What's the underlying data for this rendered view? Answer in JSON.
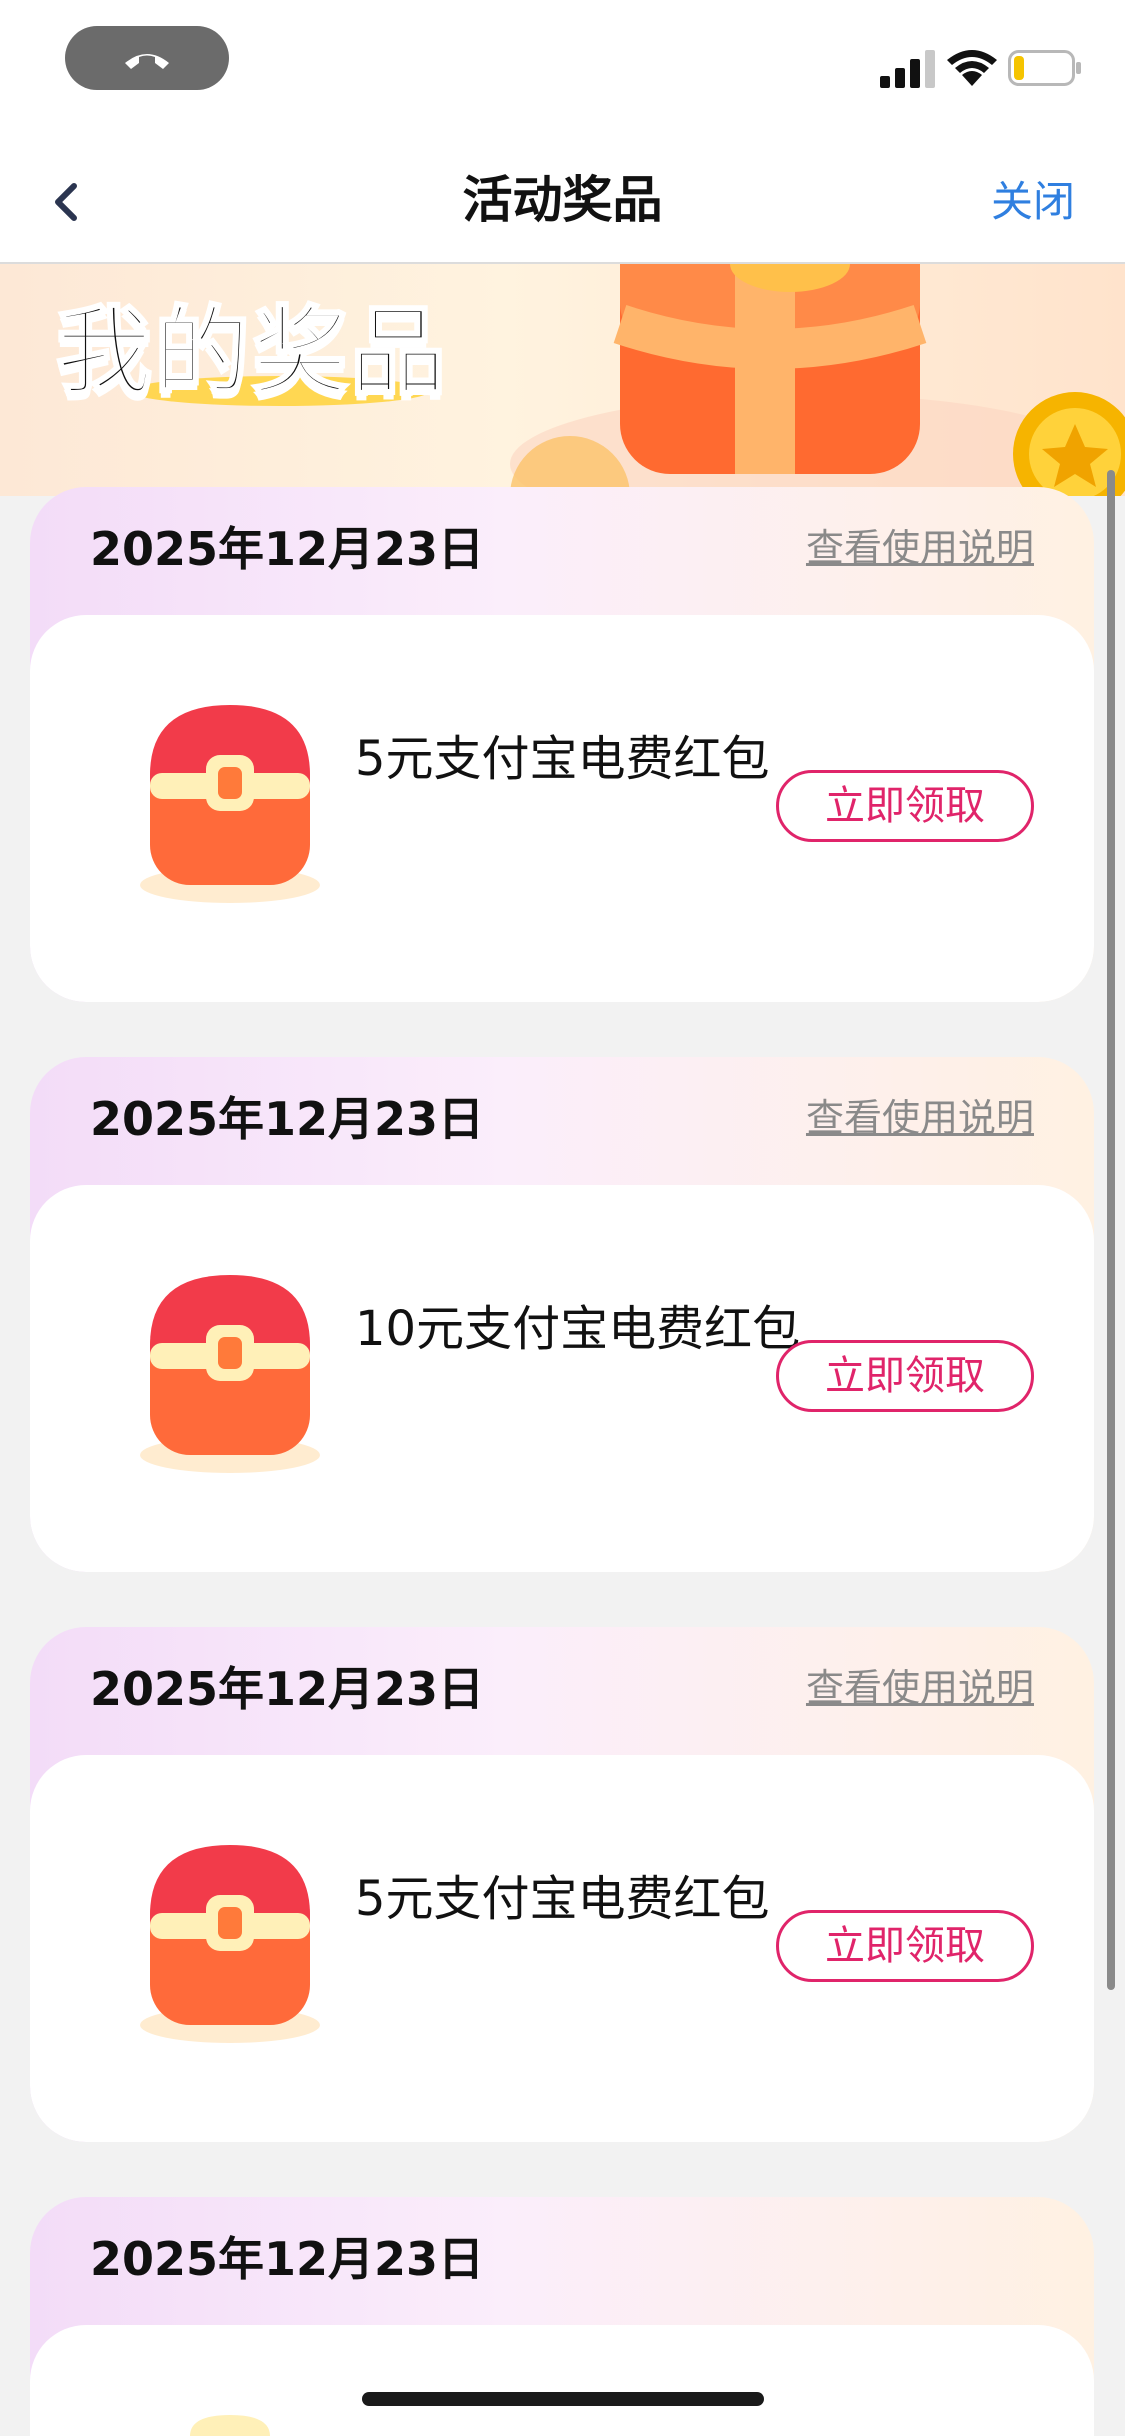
{
  "status_bar": {
    "icons": [
      "phone-call-icon",
      "signal-icon",
      "wifi-icon",
      "battery-icon"
    ]
  },
  "nav": {
    "title": "活动奖品",
    "close_label": "关闭",
    "back_icon": "chevron-left-icon"
  },
  "hero": {
    "title": "我的奖品"
  },
  "prizes": [
    {
      "date": "2025年12月23日",
      "help_label": "查看使用说明",
      "name": "5元支付宝电费红包",
      "claim_label": "立即领取"
    },
    {
      "date": "2025年12月23日",
      "help_label": "查看使用说明",
      "name": "10元支付宝电费红包",
      "claim_label": "立即领取"
    },
    {
      "date": "2025年12月23日",
      "help_label": "查看使用说明",
      "name": "5元支付宝电费红包",
      "claim_label": "立即领取"
    },
    {
      "date": "2025年12月23日"
    }
  ],
  "colors": {
    "accent_blue": "#2f7fe0",
    "claim_pink": "#e0246a",
    "help_gray": "#8a8a8a"
  }
}
